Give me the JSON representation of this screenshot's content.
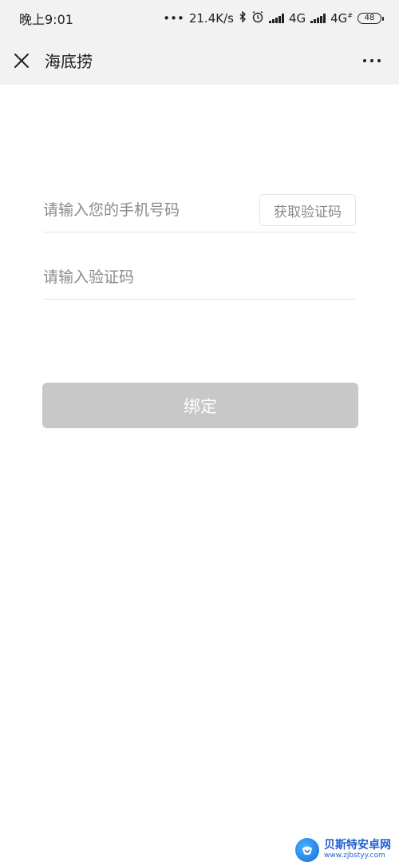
{
  "status_bar": {
    "time": "晚上9:01",
    "dots": "•••",
    "speed": "21.4K/s",
    "network1": "4G",
    "network2": "4G",
    "network2_suffix": "#",
    "battery": "48"
  },
  "nav": {
    "title": "海底捞",
    "close_icon": "close-icon",
    "more_icon": "more-dots-icon"
  },
  "form": {
    "phone_placeholder": "请输入您的手机号码",
    "get_code_label": "获取验证码",
    "code_placeholder": "请输入验证码",
    "bind_label": "绑定"
  },
  "watermark": {
    "name": "贝斯特安卓网",
    "url": "www.zjbstyy.com"
  },
  "colors": {
    "header_bg": "#f2f2f2",
    "button_disabled": "#c8c8c8",
    "placeholder": "#8a8a8a",
    "divider": "#e5e5e5"
  }
}
